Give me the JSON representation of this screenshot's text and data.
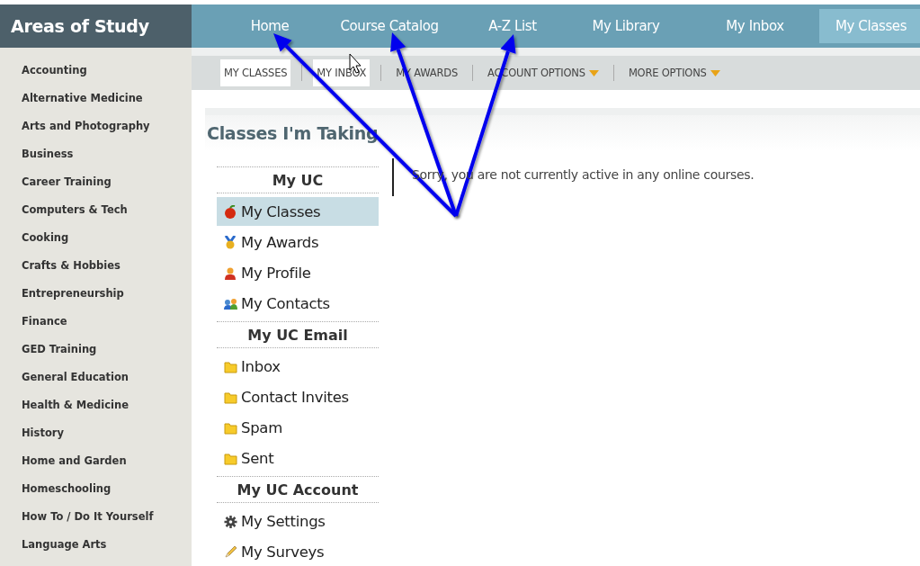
{
  "sidebar": {
    "title": "Areas of Study",
    "items": [
      {
        "label": "Accounting"
      },
      {
        "label": "Alternative Medicine"
      },
      {
        "label": "Arts and Photography"
      },
      {
        "label": "Business"
      },
      {
        "label": "Career Training"
      },
      {
        "label": "Computers & Tech"
      },
      {
        "label": "Cooking"
      },
      {
        "label": "Crafts & Hobbies"
      },
      {
        "label": "Entrepreneurship"
      },
      {
        "label": "Finance"
      },
      {
        "label": "GED Training"
      },
      {
        "label": "General Education"
      },
      {
        "label": "Health & Medicine"
      },
      {
        "label": "History"
      },
      {
        "label": "Home and Garden"
      },
      {
        "label": "Homeschooling"
      },
      {
        "label": "How To / Do It Yourself"
      },
      {
        "label": "Language Arts"
      }
    ]
  },
  "top_nav": [
    {
      "label": "Home",
      "selected": false
    },
    {
      "label": "Course Catalog",
      "selected": false
    },
    {
      "label": "A-Z List",
      "selected": false
    },
    {
      "label": "My Library",
      "selected": false
    },
    {
      "label": "My Inbox",
      "selected": false
    },
    {
      "label": "My Classes",
      "selected": true
    }
  ],
  "sub_nav": [
    {
      "label": "MY CLASSES",
      "highlighted": true,
      "dropdown": false
    },
    {
      "label": "MY INBOX",
      "highlighted": true,
      "dropdown": false
    },
    {
      "label": "MY AWARDS",
      "highlighted": false,
      "dropdown": false
    },
    {
      "label": "ACCOUNT OPTIONS",
      "highlighted": false,
      "dropdown": true
    },
    {
      "label": "MORE OPTIONS",
      "highlighted": false,
      "dropdown": true
    }
  ],
  "panel": {
    "title": "Classes I'm Taking",
    "message": "Sorry, you are not currently active in any online courses.",
    "menu": [
      {
        "kind": "header",
        "label": "My UC"
      },
      {
        "kind": "link",
        "label": "My Classes",
        "selected": true
      },
      {
        "kind": "link",
        "label": "My Awards",
        "selected": false
      },
      {
        "kind": "link",
        "label": "My Profile",
        "selected": false
      },
      {
        "kind": "link",
        "label": "My Contacts",
        "selected": false
      },
      {
        "kind": "header",
        "label": "My UC Email"
      },
      {
        "kind": "link",
        "label": "Inbox",
        "selected": false
      },
      {
        "kind": "link",
        "label": "Contact Invites",
        "selected": false
      },
      {
        "kind": "link",
        "label": "Spam",
        "selected": false
      },
      {
        "kind": "link",
        "label": "Sent",
        "selected": false
      },
      {
        "kind": "header",
        "label": "My UC Account"
      },
      {
        "kind": "link",
        "label": "My Settings",
        "selected": false
      },
      {
        "kind": "link",
        "label": "My Surveys",
        "selected": false
      }
    ]
  }
}
